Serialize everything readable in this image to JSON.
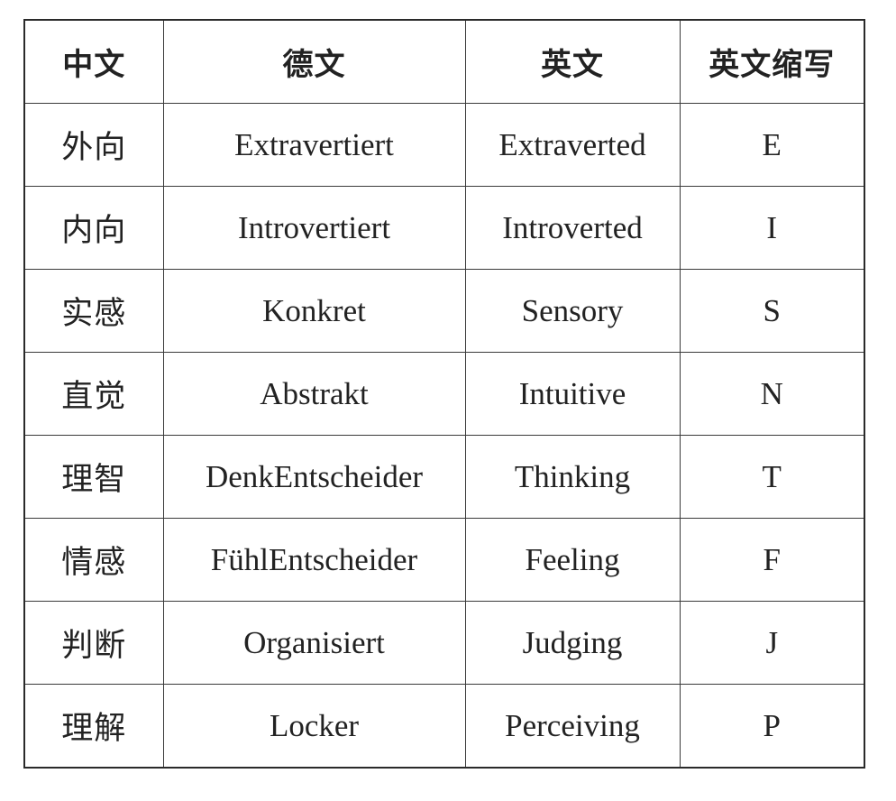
{
  "table": {
    "headers": [
      "中文",
      "德文",
      "英文",
      "英文缩写"
    ],
    "rows": [
      [
        "外向",
        "Extravertiert",
        "Extraverted",
        "E"
      ],
      [
        "内向",
        "Introvertiert",
        "Introverted",
        "I"
      ],
      [
        "实感",
        "Konkret",
        "Sensory",
        "S"
      ],
      [
        "直觉",
        "Abstrakt",
        "Intuitive",
        "N"
      ],
      [
        "理智",
        "DenkEntscheider",
        "Thinking",
        "T"
      ],
      [
        "情感",
        "FühlEntscheider",
        "Feeling",
        "F"
      ],
      [
        "判断",
        "Organisiert",
        "Judging",
        "J"
      ],
      [
        "理解",
        "Locker",
        "Perceiving",
        "P"
      ]
    ]
  }
}
